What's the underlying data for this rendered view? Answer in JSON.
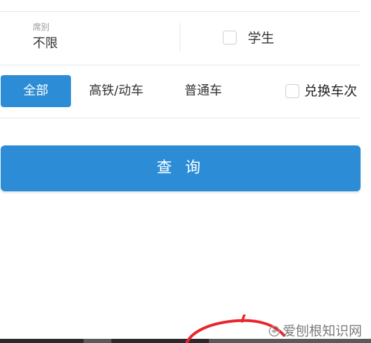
{
  "form": {
    "seat": {
      "label": "席别",
      "value": "不限"
    },
    "student": {
      "label": "学生",
      "checked": false
    }
  },
  "train_filter": {
    "tabs": [
      {
        "label": "全部",
        "selected": true
      },
      {
        "label": "高铁/动车",
        "selected": false
      },
      {
        "label": "普通车",
        "selected": false
      }
    ],
    "exchange": {
      "label": "兑换车次",
      "checked": false
    }
  },
  "query_button": {
    "label": "查 询"
  },
  "watermark": {
    "text": "爱刨根知识网"
  },
  "colors": {
    "accent": "#2c8dd6",
    "divider": "#e6e6e6",
    "annotation": "#e8262c"
  }
}
